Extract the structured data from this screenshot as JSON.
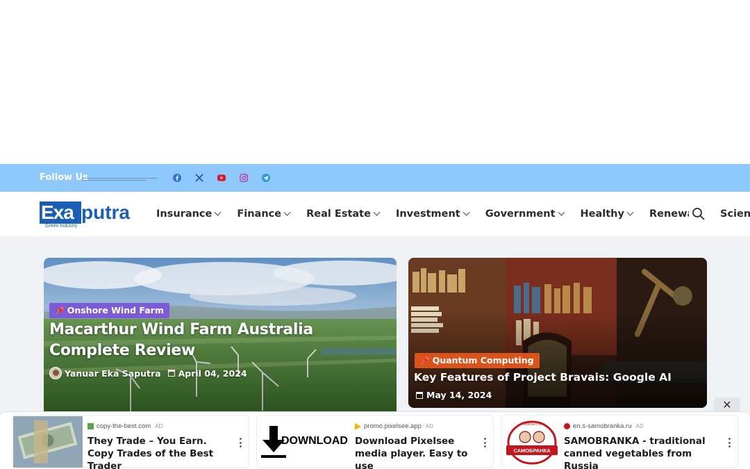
{
  "social": {
    "follow_label": "Follow Us",
    "icons": [
      "facebook-icon",
      "x-icon",
      "youtube-icon",
      "instagram-icon",
      "telegram-icon"
    ],
    "bar_color": "#8fc8fb"
  },
  "logo": {
    "box_text": "Exa",
    "rest_text": "putra",
    "tagline": "Green Industry",
    "color": "#1a5fb4"
  },
  "nav": {
    "items": [
      {
        "label": "Insurance"
      },
      {
        "label": "Finance"
      },
      {
        "label": "Real Estate"
      },
      {
        "label": "Investment"
      },
      {
        "label": "Government"
      },
      {
        "label": "Healthy"
      },
      {
        "label": "Renewable Energy"
      }
    ],
    "overflow_item": "Science"
  },
  "featured": [
    {
      "category": "Onshore Wind Farm",
      "category_color": "#7c5cd6",
      "title": "Macarthur Wind Farm Australia Complete Review",
      "author": "Yanuar Eka Saputra",
      "date": "April 04, 2024"
    },
    {
      "category": "Quantum Computing",
      "category_color": "#d9541b",
      "title": "Key Features of Project Bravais: Google AI",
      "date": "May 14, 2024"
    }
  ],
  "ads": {
    "close_symbol": "✕",
    "items": [
      {
        "source": "copy-the-best.com",
        "tag": "AD",
        "title": "They Trade – You Earn. Copy Trades of the Best Trader"
      },
      {
        "source": "promo.pixelsee.app",
        "tag": "AD",
        "thumb_text": "DOWNLOAD",
        "title": "Download Pixelsee media player. Easy to use"
      },
      {
        "source": "en.s-samobranka.ru",
        "tag": "AD",
        "thumb_text": "САМОБРАНКА",
        "thumb_subtext": "СКАТЕРТЬ",
        "title": "SAMOBRANKA - traditional canned vegetables from Russia"
      }
    ]
  }
}
